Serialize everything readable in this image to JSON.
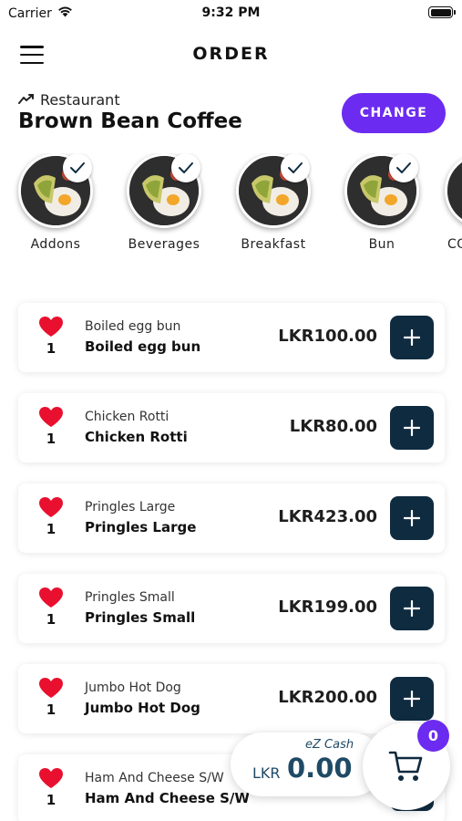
{
  "status_bar": {
    "carrier": "Carrier",
    "time": "9:32 PM"
  },
  "header": {
    "title": "ORDER"
  },
  "restaurant": {
    "label": "Restaurant",
    "name": "Brown Bean Coffee",
    "change_label": "CHANGE"
  },
  "categories": [
    {
      "label": "Addons",
      "selected": true
    },
    {
      "label": "Beverages",
      "selected": true
    },
    {
      "label": "Breakfast",
      "selected": true
    },
    {
      "label": "Bun",
      "selected": true
    },
    {
      "label": "CO",
      "selected": false
    }
  ],
  "items": [
    {
      "small_name": "Boiled egg bun",
      "name": "Boiled egg bun",
      "price": "LKR100.00",
      "fav_count": "1"
    },
    {
      "small_name": "Chicken Rotti",
      "name": "Chicken Rotti",
      "price": "LKR80.00",
      "fav_count": "1"
    },
    {
      "small_name": "Pringles Large",
      "name": "Pringles Large",
      "price": "LKR423.00",
      "fav_count": "1"
    },
    {
      "small_name": "Pringles Small",
      "name": "Pringles Small",
      "price": "LKR199.00",
      "fav_count": "1"
    },
    {
      "small_name": "Jumbo Hot Dog",
      "name": "Jumbo Hot Dog",
      "price": "LKR200.00",
      "fav_count": "1"
    },
    {
      "small_name": "Ham And Cheese S/W",
      "name": "Ham And Cheese S/W",
      "price": "",
      "fav_count": "1"
    }
  ],
  "wallet": {
    "label": "eZ Cash",
    "currency": "LKR",
    "amount": "0.00"
  },
  "cart": {
    "count": "0"
  },
  "colors": {
    "accent": "#6c2bf0",
    "add_button": "#0f2b40",
    "heart": "#e8102e",
    "wallet_text": "#1f4a66"
  }
}
